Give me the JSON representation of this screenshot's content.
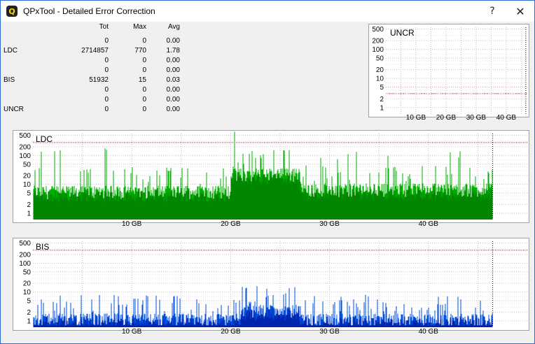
{
  "window": {
    "title": "QPxTool - Detailed Error Correction",
    "app_icon": "Q",
    "help_label": "?",
    "close_label": "✕"
  },
  "stats": {
    "headers": [
      "Tot",
      "Max",
      "Avg"
    ],
    "rows": [
      {
        "label": "",
        "tot": "0",
        "max": "0",
        "avg": "0.00"
      },
      {
        "label": "LDC",
        "tot": "2714857",
        "max": "770",
        "avg": "1.78"
      },
      {
        "label": "",
        "tot": "0",
        "max": "0",
        "avg": "0.00"
      },
      {
        "label": "",
        "tot": "0",
        "max": "0",
        "avg": "0.00"
      },
      {
        "label": "BIS",
        "tot": "51932",
        "max": "15",
        "avg": "0.03"
      },
      {
        "label": "",
        "tot": "0",
        "max": "0",
        "avg": "0.00"
      },
      {
        "label": "",
        "tot": "0",
        "max": "0",
        "avg": "0.00"
      },
      {
        "label": "UNCR",
        "tot": "0",
        "max": "0",
        "avg": "0.00"
      }
    ]
  },
  "colors": {
    "ldc": "#00b000",
    "ldc_dark": "#006400",
    "bis": "#0050e0",
    "bis_dark": "#000080",
    "grid": "#c0c0c0",
    "limit": "#cc0000"
  },
  "chart_data": [
    {
      "type": "bar",
      "title": "UNCR",
      "y_ticks": [
        "500",
        "200",
        "100",
        "50",
        "20",
        "10",
        "5",
        "2",
        "1"
      ],
      "x_ticks": [
        "10 GB",
        "20 GB",
        "30 GB",
        "40 GB"
      ],
      "y_scale": "log",
      "ylim": [
        1,
        500
      ],
      "x_unit": "GB",
      "xlim": [
        0,
        47
      ],
      "values": [],
      "end_marker_gb": 46.5,
      "limit_line": 3
    },
    {
      "type": "bar",
      "title": "LDC",
      "y_ticks": [
        "500",
        "200",
        "100",
        "50",
        "20",
        "10",
        "5",
        "2",
        "1"
      ],
      "x_ticks": [
        "10 GB",
        "20 GB",
        "30 GB",
        "40 GB"
      ],
      "y_scale": "log",
      "ylim": [
        1,
        500
      ],
      "x_unit": "GB",
      "xlim": [
        0,
        50
      ],
      "end_marker_gb": 46.5,
      "limit_line": 280,
      "series_segments": [
        {
          "from_gb": 0,
          "to_gb": 20,
          "typical": 5,
          "peak": 200
        },
        {
          "from_gb": 20,
          "to_gb": 27,
          "typical": 20,
          "peak": 770
        },
        {
          "from_gb": 27,
          "to_gb": 46.5,
          "typical": 6,
          "peak": 150
        }
      ]
    },
    {
      "type": "bar",
      "title": "BIS",
      "y_ticks": [
        "500",
        "200",
        "100",
        "50",
        "20",
        "10",
        "5",
        "2",
        "1"
      ],
      "x_ticks": [
        "10 GB",
        "20 GB",
        "30 GB",
        "40 GB"
      ],
      "y_scale": "log",
      "ylim": [
        1,
        500
      ],
      "x_unit": "GB",
      "xlim": [
        0,
        50
      ],
      "end_marker_gb": 46.5,
      "limit_line": 280,
      "series_segments": [
        {
          "from_gb": 0,
          "to_gb": 21,
          "typical": 1,
          "peak": 5
        },
        {
          "from_gb": 21,
          "to_gb": 27,
          "typical": 2,
          "peak": 15
        },
        {
          "from_gb": 27,
          "to_gb": 46.5,
          "typical": 1,
          "peak": 5
        }
      ]
    }
  ]
}
